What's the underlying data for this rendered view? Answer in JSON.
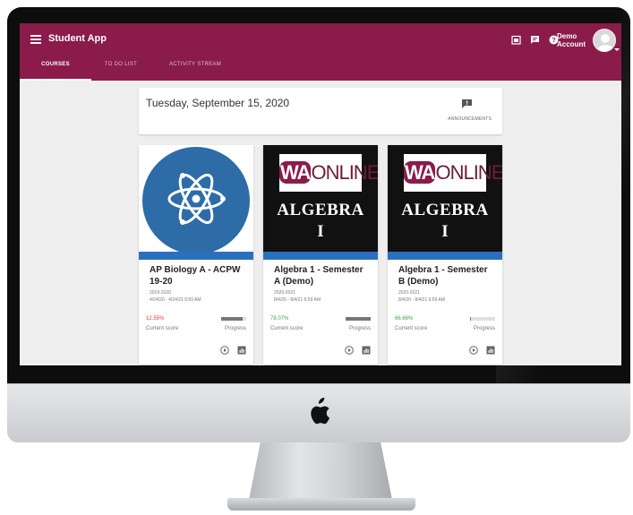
{
  "app": {
    "title": "Student App"
  },
  "user": {
    "name": "Demo Account"
  },
  "tabs": [
    {
      "label": "COURSES",
      "active": true
    },
    {
      "label": "TO DO LIST",
      "active": false
    },
    {
      "label": "ACTIVITY STREAM",
      "active": false
    }
  ],
  "header_icons": [
    "calendar-icon",
    "message-icon",
    "help-icon"
  ],
  "date_card": {
    "date": "Tuesday, September 15, 2020",
    "announcements_label": "ANNOUNCEMENTS",
    "announcements_icon": "announcement-icon"
  },
  "courses": [
    {
      "name": "AP Biology A - ACPW 19-20",
      "term": "2019-2020",
      "dates": "4/24/20 - 4/24/21 6:59 AM",
      "score": "12.55%",
      "score_label": "Current score",
      "progress": 0.85,
      "progress_label": "Progress",
      "thumbnail": "atom-icon"
    },
    {
      "name": "Algebra 1 - Semester A (Demo)",
      "term": "2020-2021",
      "dates": "8/4/20 - 8/4/21 6:59 AM",
      "score": "78.07%",
      "score_label": "Current score",
      "progress": 1.0,
      "progress_label": "Progress",
      "thumbnail_brand_wa": "WA",
      "thumbnail_brand_online": "ONLINE",
      "thumbnail_title": "ALGEBRA",
      "thumbnail_sub": "I"
    },
    {
      "name": "Algebra 1 - Semester B (Demo)",
      "term": "2020-2021",
      "dates": "8/4/20 - 8/4/21 6:59 AM",
      "score": "66.66%",
      "score_label": "Current score",
      "progress": 0.05,
      "progress_label": "Progress",
      "thumbnail_brand_wa": "WA",
      "thumbnail_brand_online": "ONLINE",
      "thumbnail_title": "ALGEBRA",
      "thumbnail_sub": "I"
    }
  ],
  "card_actions": [
    "play-icon",
    "grades-icon"
  ],
  "colors": {
    "brand": "#8a1b4a",
    "accent_bar": "#2c6fbf",
    "score_low": "#e53935",
    "score_ok": "#43a047",
    "bio_circle": "#2e6ca8"
  }
}
